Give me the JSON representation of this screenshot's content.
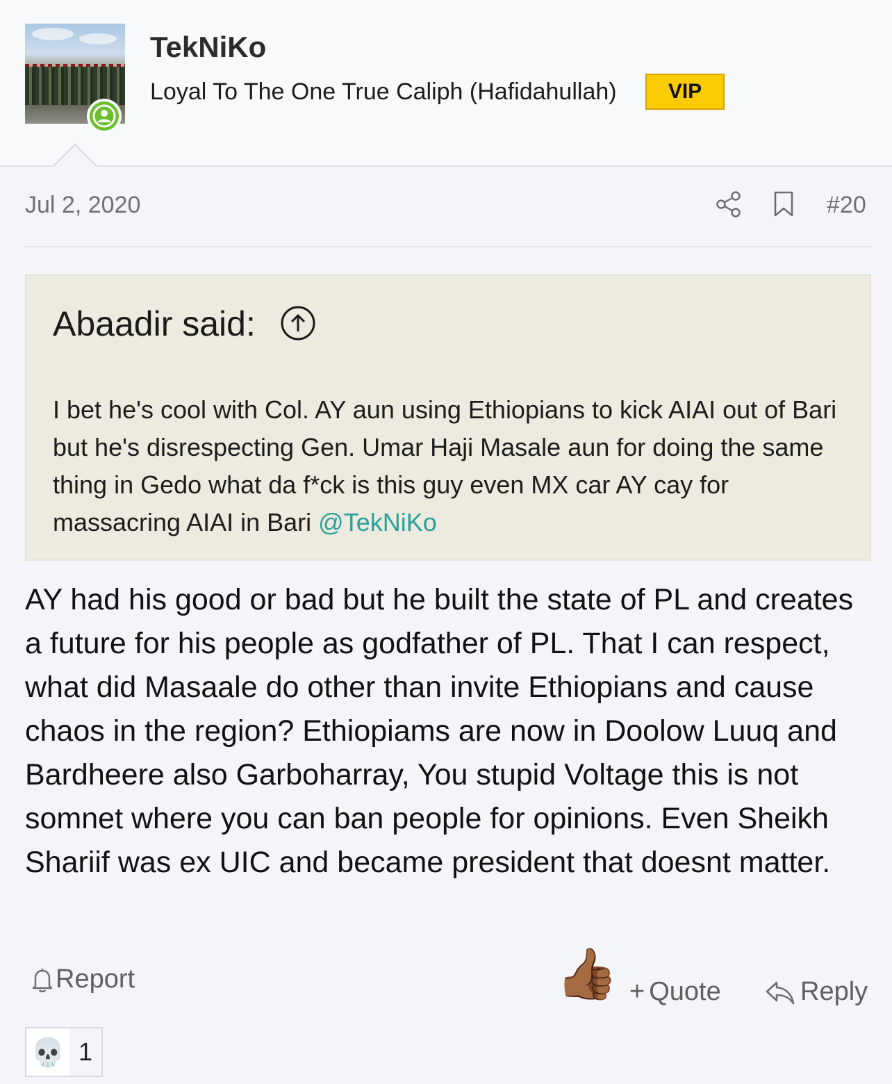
{
  "user": {
    "name": "TekNiKo",
    "title": "Loyal To The One True Caliph (Hafidahullah)",
    "badge": "VIP",
    "status": "online"
  },
  "post": {
    "date": "Jul 2, 2020",
    "number": "#20",
    "quote": {
      "author": "Abaadir said:",
      "text": "I bet he's cool with Col. AY aun using Ethiopians to kick AIAI out of Bari but he's disrespecting Gen. Umar Haji Masale aun for doing the same thing in Gedo what da f*ck is this guy even MX car AY cay for massacring AIAI in Bari ",
      "mention": "@TekNiKo"
    },
    "body": "AY had his good or bad but he built the state of PL and creates a future for his people as godfather of PL. That I can respect, what did Masaale do other than invite Ethiopians and cause chaos in the region? Ethiopiams are now in Doolow Luuq and Bardheere also Garboharray, You stupid Voltage this is not somnet where you can ban people for opinions. Even Sheikh Shariif was ex UIC and became president that doesnt matter."
  },
  "actions": {
    "report": "Report",
    "like_emoji": "👍🏾",
    "quote": "Quote",
    "quote_prefix": "+",
    "reply": "Reply"
  },
  "reactions": [
    {
      "emoji": "💀",
      "count": "1"
    }
  ],
  "colors": {
    "vip": "#fbcb04",
    "mention": "#2aa198",
    "online": "#6cbf2a",
    "quote_bg": "#edebe0"
  }
}
